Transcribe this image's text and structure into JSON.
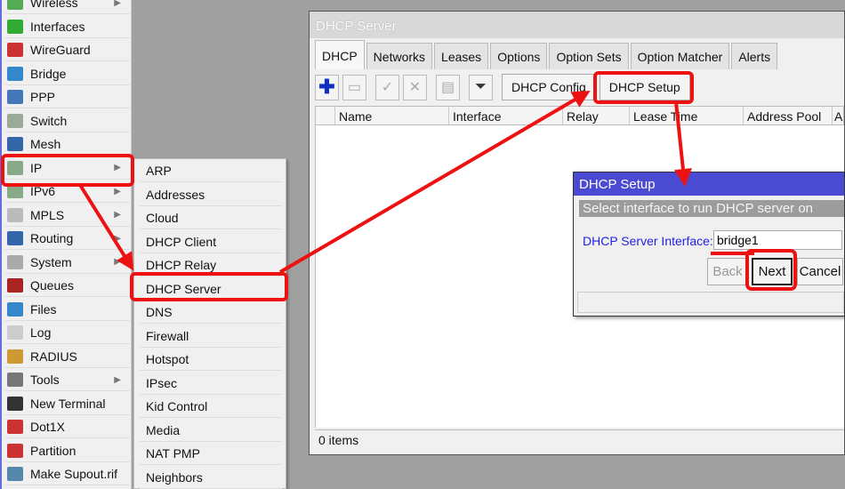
{
  "menu": {
    "items": [
      {
        "label": "Wireless",
        "icon": "wireless-icon",
        "submenu": true
      },
      {
        "label": "Interfaces",
        "icon": "interfaces-icon"
      },
      {
        "label": "WireGuard",
        "icon": "wireguard-icon"
      },
      {
        "label": "Bridge",
        "icon": "bridge-icon"
      },
      {
        "label": "PPP",
        "icon": "ppp-icon"
      },
      {
        "label": "Switch",
        "icon": "switch-icon"
      },
      {
        "label": "Mesh",
        "icon": "mesh-icon"
      },
      {
        "label": "IP",
        "icon": "ip-icon",
        "submenu": true
      },
      {
        "label": "IPv6",
        "icon": "ipv6-icon",
        "submenu": true
      },
      {
        "label": "MPLS",
        "icon": "mpls-icon",
        "submenu": true
      },
      {
        "label": "Routing",
        "icon": "routing-icon",
        "submenu": true
      },
      {
        "label": "System",
        "icon": "system-icon",
        "submenu": true
      },
      {
        "label": "Queues",
        "icon": "queues-icon"
      },
      {
        "label": "Files",
        "icon": "files-icon"
      },
      {
        "label": "Log",
        "icon": "log-icon"
      },
      {
        "label": "RADIUS",
        "icon": "radius-icon"
      },
      {
        "label": "Tools",
        "icon": "tools-icon",
        "submenu": true
      },
      {
        "label": "New Terminal",
        "icon": "terminal-icon"
      },
      {
        "label": "Dot1X",
        "icon": "dot1x-icon"
      },
      {
        "label": "Partition",
        "icon": "partition-icon"
      },
      {
        "label": "Make Supout.rif",
        "icon": "supout-icon"
      }
    ]
  },
  "submenu": {
    "items": [
      "ARP",
      "Addresses",
      "Cloud",
      "DHCP Client",
      "DHCP Relay",
      "DHCP Server",
      "DNS",
      "Firewall",
      "Hotspot",
      "IPsec",
      "Kid Control",
      "Media",
      "NAT PMP",
      "Neighbors"
    ]
  },
  "window": {
    "title": "DHCP Server",
    "tabs": [
      "DHCP",
      "Networks",
      "Leases",
      "Options",
      "Option Sets",
      "Option Matcher",
      "Alerts"
    ],
    "toolbar": {
      "dhcp_config": "DHCP Config",
      "dhcp_setup": "DHCP Setup"
    },
    "columns": [
      "Name",
      "Interface",
      "Relay",
      "Lease Time",
      "Address Pool",
      "A"
    ],
    "status": "0 items"
  },
  "dialog": {
    "title": "DHCP Setup",
    "subtitle": "Select interface to run DHCP server on",
    "label": "DHCP Server Interface:",
    "value": "bridge1",
    "back": "Back",
    "next": "Next",
    "cancel": "Cancel"
  },
  "colors": {
    "annotation": "#ee1111",
    "dialog_title": "#4a4ad2",
    "label": "#2222e0"
  }
}
